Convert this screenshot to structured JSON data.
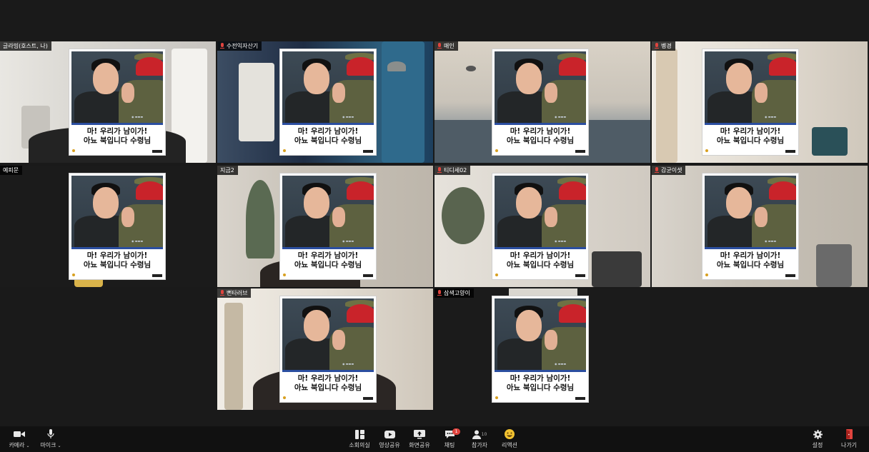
{
  "meeting": {
    "tiles": [
      {
        "name": "글라밍(호스트, 나)",
        "active": true
      },
      {
        "name": "수전익자산기",
        "active": false
      },
      {
        "name": "매인",
        "active": false
      },
      {
        "name": "벵경",
        "active": false
      },
      {
        "name": "예피문",
        "active": false
      },
      {
        "name": "지금2",
        "active": true
      },
      {
        "name": "티디세02",
        "active": false
      },
      {
        "name": "감균이셋",
        "active": false
      },
      {
        "name": "뻔타러브",
        "active": false
      },
      {
        "name": "삼색고양이",
        "active": false
      }
    ],
    "card_caption_line1": "마! 우리가 남이가!",
    "card_caption_line2": "아뇨  북입니다 수령님"
  },
  "toolbar": {
    "camera_label": "카메라",
    "mic_label": "마이크",
    "breakout_label": "소회의실",
    "video_share_label": "영상공유",
    "screen_share_label": "화면공유",
    "chat_label": "채팅",
    "chat_badge": "1",
    "participants_label": "참가자",
    "participants_count": "10",
    "reaction_label": "리액션",
    "settings_label": "설정",
    "leave_label": "나가기",
    "caret": "⌄"
  },
  "colors": {
    "active_border": "#2bb58f",
    "muted_mic": "#e0443e",
    "toolbar_bg": "#111111"
  }
}
